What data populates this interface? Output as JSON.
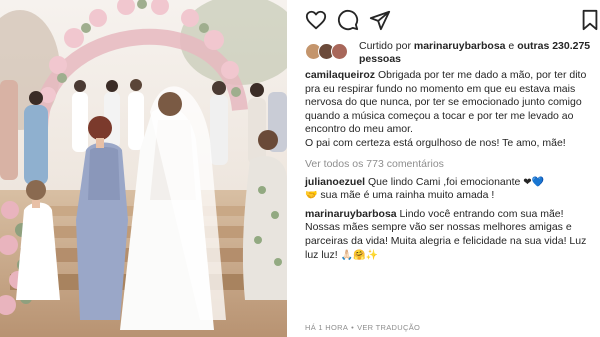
{
  "post": {
    "liked_by_prefix": "Curtido por",
    "liked_by_user": "marinaruybarbosa",
    "liked_by_connector": "e",
    "liked_by_count": "outras 230.275 pessoas",
    "caption_user": "camilaqueiroz",
    "caption_text": "Obrigada por ter me dado a mão, por ter dito pra eu respirar fundo no momento em que eu estava mais nervosa do que nunca, por ter se emocionado junto comigo quando a música começou a tocar e por ter me levado ao encontro do meu amor.",
    "caption_text_2": "O pai com certeza está orgulhoso de nos! Te amo, mãe!",
    "view_comments": "Ver todos os 773 comentários",
    "comments": [
      {
        "user": "julianoezuel",
        "text_a": "Que lindo Cami ,foi emocionante",
        "emoji_a": "❤💙",
        "emoji_b": "🤝",
        "text_b": "sua mãe é uma rainha muito amada !"
      },
      {
        "user": "marinaruybarbosa",
        "text_a": "Lindo você entrando com sua mãe! Nossas mães sempre vão ser nossas melhores amigas e parceiras da vida! Muita alegria e felicidade na sua vida! Luz luz luz!",
        "emoji_a": "🙏🏻🤗✨"
      }
    ],
    "timestamp": "HÁ 1 HORA",
    "separator": "•",
    "translate_label": "VER TRADUÇÃO"
  },
  "icons": {
    "like": "heart-icon",
    "comment": "comment-icon",
    "share": "share-icon",
    "save": "bookmark-icon"
  },
  "colors": {
    "text": "#262626",
    "muted": "#8e8e8e",
    "heart_red": "#ed4956"
  }
}
